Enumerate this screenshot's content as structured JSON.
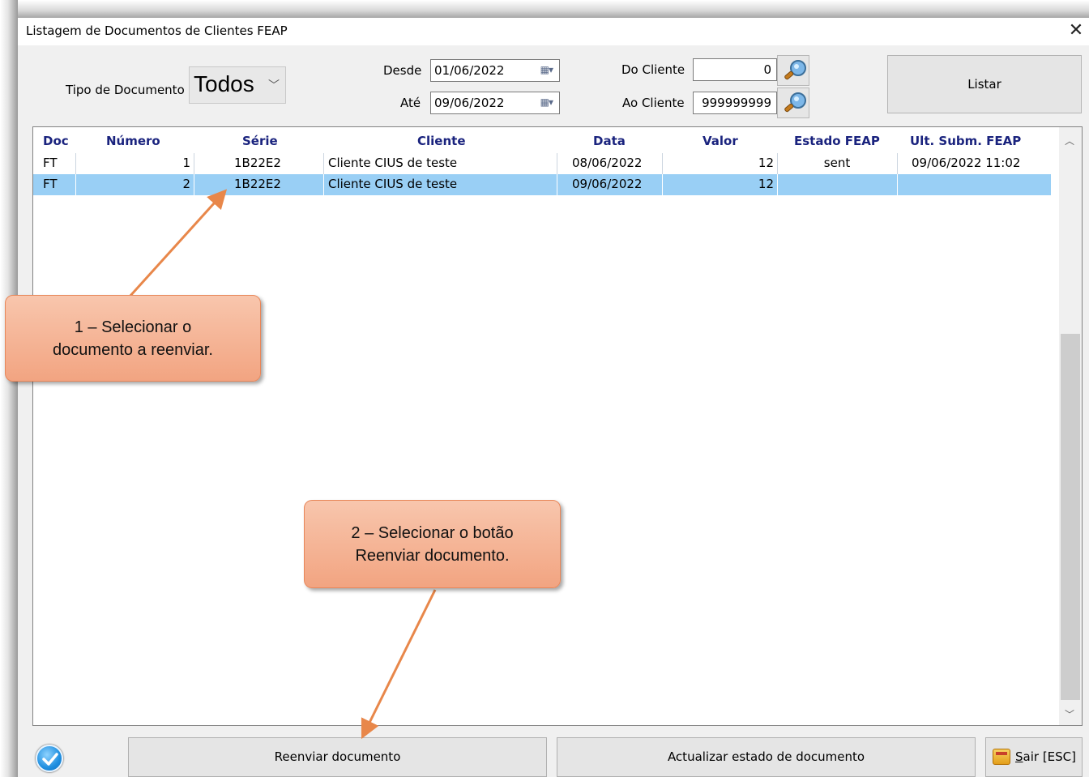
{
  "window": {
    "title": "Listagem de Documentos de Clientes FEAP",
    "close_glyph": "✕"
  },
  "filters": {
    "tipo_label": "Tipo de Documento",
    "tipo_value": "Todos",
    "desde_label": "Desde",
    "desde_value": "01/06/2022",
    "ate_label": "Até",
    "ate_value": "09/06/2022",
    "do_cliente_label": "Do Cliente",
    "do_cliente_value": "0",
    "ao_cliente_label": "Ao Cliente",
    "ao_cliente_value": "999999999",
    "listar_label": "Listar"
  },
  "table": {
    "headers": [
      "Doc",
      "Número",
      "Série",
      "Cliente",
      "Data",
      "Valor",
      "Estado FEAP",
      "Ult. Subm. FEAP"
    ],
    "rows": [
      [
        "FT",
        "1",
        "1B22E2",
        "Cliente CIUS de teste",
        "08/06/2022",
        "12",
        "sent",
        "09/06/2022 11:02"
      ],
      [
        "FT",
        "2",
        "1B22E2",
        "Cliente CIUS de teste",
        "09/06/2022",
        "12",
        "",
        ""
      ]
    ],
    "selected_row": 1
  },
  "annotations": {
    "step1": [
      "1 – Selecionar o",
      "documento a reenviar."
    ],
    "step2": [
      "2 – Selecionar o botão",
      "Reenviar documento."
    ]
  },
  "footer": {
    "reenviar_label": "Reenviar documento",
    "actualizar_label": "Actualizar estado de documento",
    "sair_hotkey": "S",
    "sair_label": "air [ESC]"
  },
  "colors": {
    "selected_row": "#99cff5",
    "header_text": "#1a237e",
    "callout": "#f4ad8c",
    "arrow": "#e8874a"
  }
}
